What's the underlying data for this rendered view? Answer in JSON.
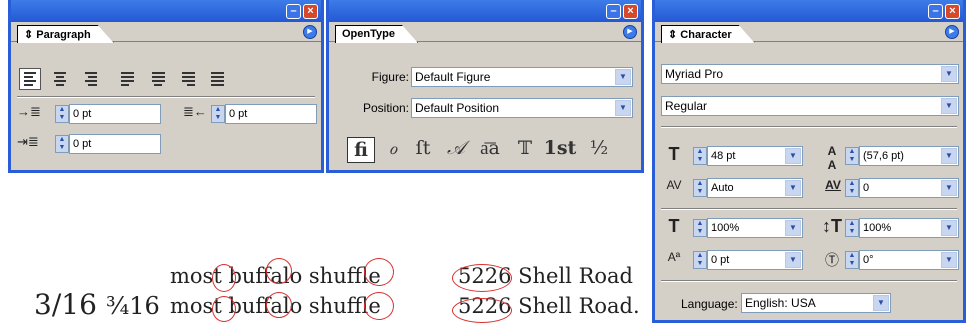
{
  "paragraph": {
    "tab": "Paragraph",
    "left_indent": "0 pt",
    "right_indent": "0 pt",
    "first_line_indent": "0 pt"
  },
  "opentype": {
    "tab": "OpenType",
    "figure_label": "Figure:",
    "figure_value": "Default Figure",
    "position_label": "Position:",
    "position_value": "Default Position",
    "glyphs": [
      "fi",
      "ℴ",
      "ſt",
      "𝒜",
      "a͞a",
      "𝕋",
      "1st",
      "½"
    ]
  },
  "character": {
    "tab": "Character",
    "font_family": "Myriad Pro",
    "font_style": "Regular",
    "font_size": "48 pt",
    "leading": "(57,6 pt)",
    "kerning": "Auto",
    "tracking": "0",
    "vertical_scale": "100%",
    "horizontal_scale": "100%",
    "baseline_shift": "0 pt",
    "skew": "0°",
    "language_label": "Language:",
    "language_value": "English: USA"
  },
  "samples": {
    "line1a": "most buffalo shuffle",
    "line1b": "5226 Shell Road",
    "frac1": "3/16",
    "frac2": "¾16",
    "line2a": "most buffalo shuffle",
    "line2b": "5226 Shell Road."
  }
}
